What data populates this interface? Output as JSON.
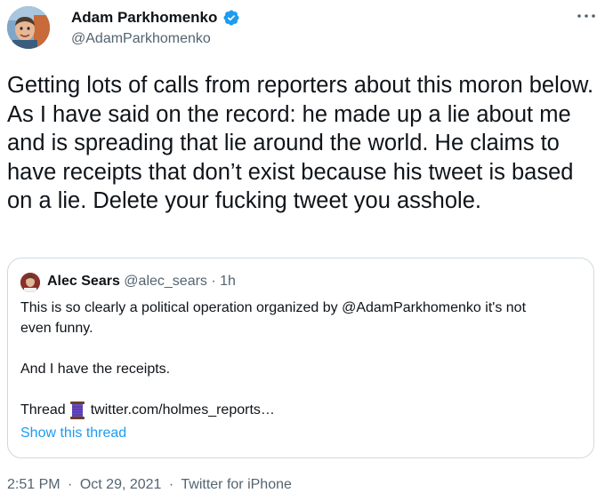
{
  "author": {
    "name": "Adam Parkhomenko",
    "handle": "@AdamParkhomenko",
    "verified": true,
    "avatar_icon": "user-avatar"
  },
  "tweet": {
    "text": "Getting lots of calls from reporters about this moron below. As I have said on the record: he made up a lie about me and is spreading that lie around the world. He claims to have receipts that don’t exist because his tweet is based on a lie. Delete your fucking tweet you asshole."
  },
  "quote": {
    "author_name": "Alec Sears",
    "author_handle": "@alec_sears",
    "separator": "·",
    "time": "1h",
    "lines": [
      "This is so clearly a political operation organized by @AdamParkhomenko it's not",
      "even funny.",
      "",
      "And I have the receipts."
    ],
    "thread_label": "Thread",
    "thread_emoji_icon": "spool-of-thread-icon",
    "thread_link": "twitter.com/holmes_reports…",
    "show_thread_label": "Show this thread"
  },
  "meta": {
    "time": "2:51 PM",
    "separator": "·",
    "date": "Oct 29, 2021",
    "source": "Twitter for iPhone"
  },
  "colors": {
    "text": "#0f1419",
    "secondary": "#536471",
    "link": "#1d9bf0",
    "border": "#cfd9de",
    "verified": "#1d9bf0"
  }
}
